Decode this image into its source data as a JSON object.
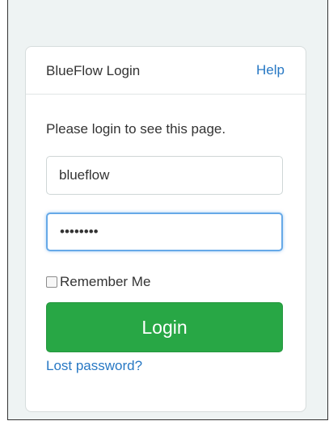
{
  "login_card": {
    "title": "BlueFlow Login",
    "help_label": "Help",
    "instructions": "Please login to see this page.",
    "username_value": "blueflow",
    "password_value": "••••••••",
    "remember_label": "Remember Me",
    "remember_checked": false,
    "login_button_label": "Login",
    "lost_password_label": "Lost password?"
  },
  "colors": {
    "background": "#eef3f3",
    "card_background": "#ffffff",
    "link": "#2778c4",
    "login_button": "#28a745",
    "focus_border": "#66a9e8"
  }
}
